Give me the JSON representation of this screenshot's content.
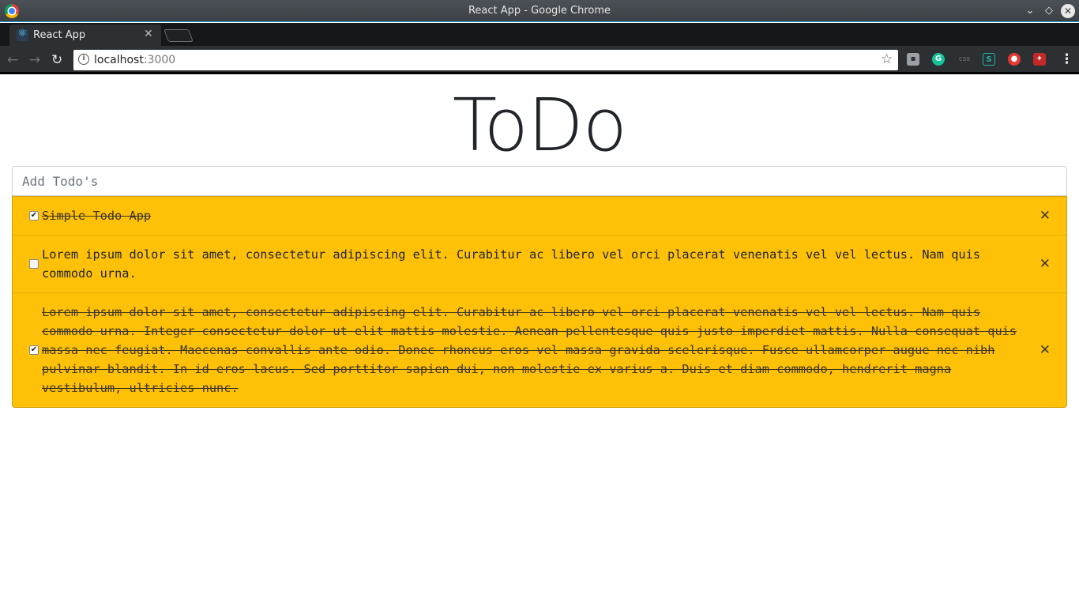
{
  "window": {
    "title": "React App - Google Chrome"
  },
  "tab": {
    "title": "React App",
    "icon": "react-icon"
  },
  "toolbar": {
    "url_host": "localhost",
    "url_port": ":3000",
    "extensions": [
      "extension-icon",
      "grammarly-icon",
      "css",
      "S",
      "ublock-icon",
      "extension-icon"
    ]
  },
  "page": {
    "title": "ToDo",
    "input_placeholder": "Add Todo's"
  },
  "todos": [
    {
      "text": "Simple Todo App",
      "done": true
    },
    {
      "text": "Lorem ipsum dolor sit amet, consectetur adipiscing elit. Curabitur ac libero vel orci placerat venenatis vel vel lectus. Nam quis commodo urna.",
      "done": false
    },
    {
      "text": "Lorem ipsum dolor sit amet, consectetur adipiscing elit. Curabitur ac libero vel orci placerat venenatis vel vel lectus. Nam quis commodo urna. Integer consectetur dolor ut elit mattis molestie. Aenean pellentesque quis justo imperdiet mattis. Nulla consequat quis massa nec feugiat. Maecenas convallis ante odio. Donec rhoncus eros vel massa gravida scelerisque. Fusce ullamcorper augue nec nibh pulvinar blandit. In id eros lacus. Sed porttitor sapien dui, non molestie ex varius a. Duis et diam commodo, hendrerit magna vestibulum, ultricies nunc.",
      "done": true
    }
  ],
  "colors": {
    "todo_bg": "#ffc107",
    "title_text": "#212529"
  }
}
